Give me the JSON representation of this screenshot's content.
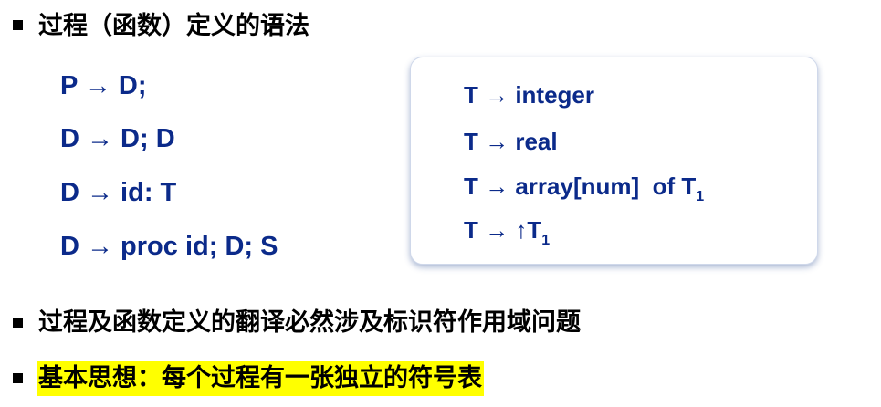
{
  "headings": [
    "过程（函数）定义的语法",
    "过程及函数定义的翻译必然涉及标识符作用域问题",
    "基本思想：每个过程有一张独立的符号表"
  ],
  "grammar_rules": [
    "P → D;",
    "D → D; D",
    "D → id: T",
    "D → proc id; D; S"
  ],
  "type_rules": [
    {
      "text": "T → integer",
      "sub": ""
    },
    {
      "text": "T → real",
      "sub": ""
    },
    {
      "text": "T → array[num]  of T",
      "sub": "1"
    },
    {
      "text": "T → ↑T",
      "sub": "1"
    }
  ],
  "colors": {
    "rule_text": "#0b2a8a",
    "highlight": "#ffff00",
    "heading_text": "#000000"
  }
}
